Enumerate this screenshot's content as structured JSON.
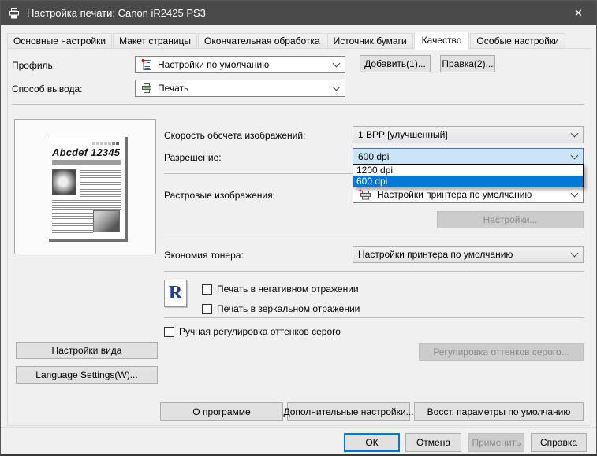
{
  "window": {
    "title": "Настройка печати: Canon iR2425 PS3",
    "close_glyph": "✕"
  },
  "tabs": [
    {
      "label": "Основные настройки"
    },
    {
      "label": "Макет страницы"
    },
    {
      "label": "Окончательная обработка"
    },
    {
      "label": "Источник бумаги"
    },
    {
      "label": "Качество"
    },
    {
      "label": "Особые настройки"
    }
  ],
  "active_tab": "Качество",
  "profile": {
    "label": "Профиль:",
    "value": "Настройки по умолчанию",
    "add_button": "Добавить(1)...",
    "edit_button": "Правка(2)..."
  },
  "output_method": {
    "label": "Способ вывода:",
    "value": "Печать"
  },
  "preview": {
    "headline": "Abcdef 12345"
  },
  "quality": {
    "speed_label": "Скорость обсчета изображений:",
    "speed_value": "1 BPP [улучшенный]",
    "resolution_label": "Разрешение:",
    "resolution_value": "600 dpi",
    "resolution_options": [
      "1200 dpi",
      "600 dpi"
    ],
    "resolution_selected": "600 dpi",
    "halftone_label": "Растровые изображения:",
    "halftone_value": "Настройки принтера по умолчанию",
    "halftone_settings_button": "Настройки...",
    "toner_label": "Экономия тонера:",
    "toner_value": "Настройки принтера по умолчанию",
    "negative_checkbox": "Печать в негативном отражении",
    "mirror_checkbox": "Печать в зеркальном отражении",
    "grayscale_checkbox": "Ручная регулировка оттенков серого",
    "grayscale_button": "Регулировка оттенков серого...",
    "r_glyph": "R"
  },
  "side_buttons": {
    "view_settings": "Настройки вида",
    "language_settings": "Language Settings(W)..."
  },
  "bottom_buttons": {
    "about": "О программе",
    "advanced": "Дополнительные настройки...",
    "restore": "Восст. параметры по умолчанию"
  },
  "footer": {
    "ok": "ОК",
    "cancel": "Отмена",
    "apply": "Применить",
    "help": "Справка"
  },
  "colors": {
    "accent": "#0078d7",
    "selection_fill": "#cce4f7",
    "titlebar": "#4a4a4a"
  }
}
